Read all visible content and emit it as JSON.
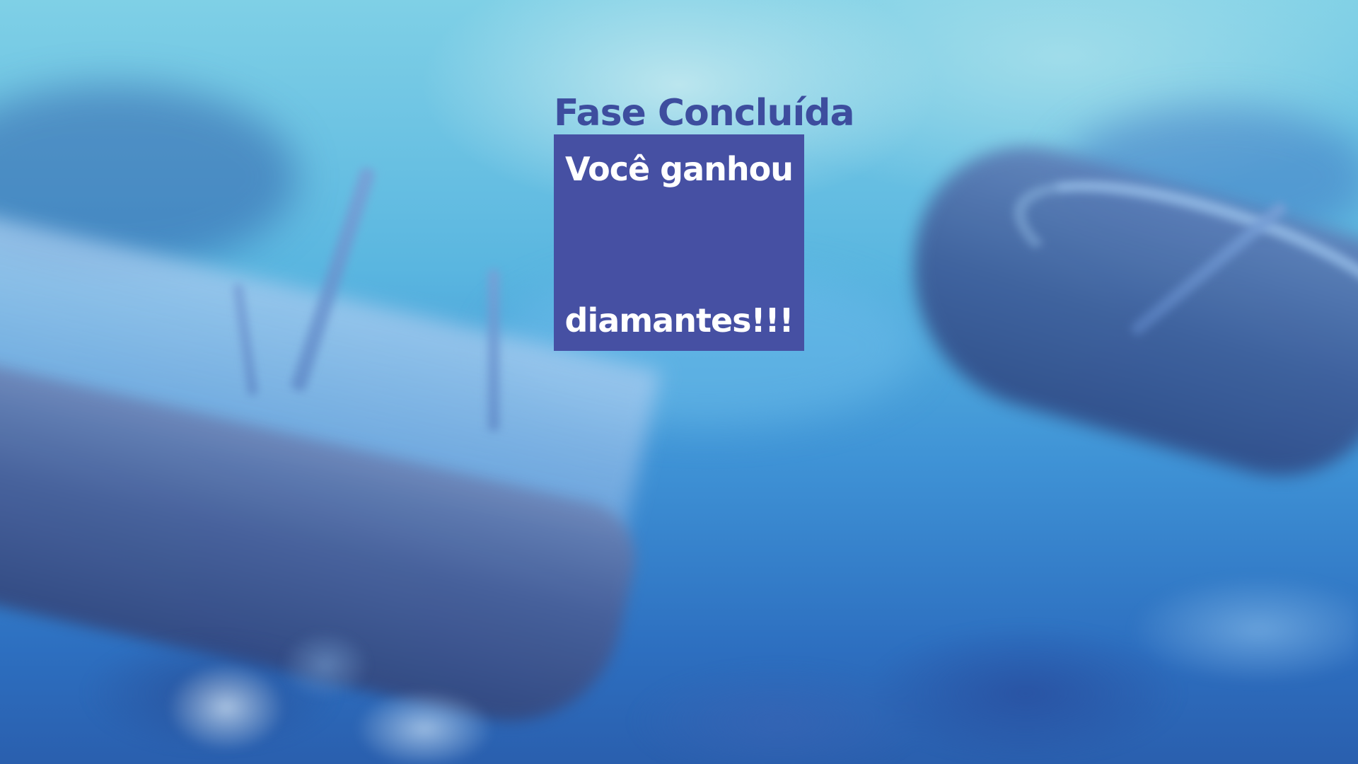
{
  "game": {
    "title": "Fase Concluída",
    "reward_panel": {
      "line_top": "Você ganhou",
      "line_bottom": "diamantes!!!",
      "background_color": "#4650a3",
      "text_color": "#ffffff"
    },
    "title_color": "#3d4d9e"
  }
}
